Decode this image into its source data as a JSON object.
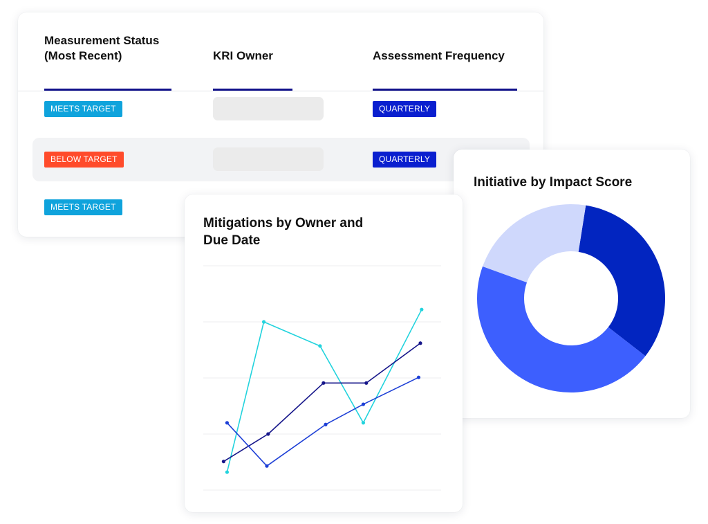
{
  "table": {
    "headers": [
      {
        "label_line1": "Measurement Status",
        "label_line2": "(Most Recent)"
      },
      {
        "label_line1": "KRI Owner",
        "label_line2": ""
      },
      {
        "label_line1": "Assessment Frequency",
        "label_line2": ""
      }
    ],
    "rows": [
      {
        "status": "MEETS TARGET",
        "status_type": "meets",
        "owner": "",
        "frequency": "QUARTERLY",
        "highlighted": false
      },
      {
        "status": "BELOW TARGET",
        "status_type": "below",
        "owner": "",
        "frequency": "QUARTERLY",
        "highlighted": true
      },
      {
        "status": "MEETS TARGET",
        "status_type": "meets",
        "owner": "",
        "frequency": "",
        "highlighted": false
      }
    ],
    "colors": {
      "header_underline": "#10108a",
      "meets_target": "#0fa3dc",
      "below_target": "#ff4b2b",
      "frequency": "#0a1fcf"
    }
  },
  "chart_data": [
    {
      "type": "line",
      "title": "Mitigations by Owner and Due Date",
      "title_line1": "Mitigations by Owner and",
      "title_line2": "Due Date",
      "xlabel": "",
      "ylabel": "",
      "ylim": [
        0,
        4
      ],
      "grid": true,
      "x": [
        1,
        2,
        3,
        4,
        5
      ],
      "series": [
        {
          "name": "series-cyan",
          "color": "#22d3dd",
          "x": [
            1.05,
            1.9,
            3.2,
            4.2,
            5.55
          ],
          "values": [
            0.32,
            3.0,
            2.57,
            1.2,
            3.22
          ]
        },
        {
          "name": "series-navy",
          "color": "#16168a",
          "x": [
            0.97,
            2.0,
            3.28,
            4.27,
            5.52
          ],
          "values": [
            0.51,
            1.0,
            1.91,
            1.91,
            2.62
          ]
        },
        {
          "name": "series-blue",
          "color": "#1d3fd6",
          "x": [
            1.05,
            1.97,
            3.33,
            4.2,
            5.48
          ],
          "values": [
            1.2,
            0.43,
            1.17,
            1.53,
            2.01
          ]
        }
      ],
      "xlim": [
        0.5,
        6.0
      ]
    },
    {
      "type": "pie",
      "variant": "donut",
      "title": "Initiative by Impact Score",
      "start_angle_deg": 9,
      "slices": [
        {
          "name": "segment-dark-blue",
          "value": 0.33,
          "color": "#0225c0"
        },
        {
          "name": "segment-medium-blue",
          "value": 0.45,
          "color": "#3d5ffe"
        },
        {
          "name": "segment-light-blue",
          "value": 0.22,
          "color": "#cfd8fc"
        }
      ]
    }
  ]
}
